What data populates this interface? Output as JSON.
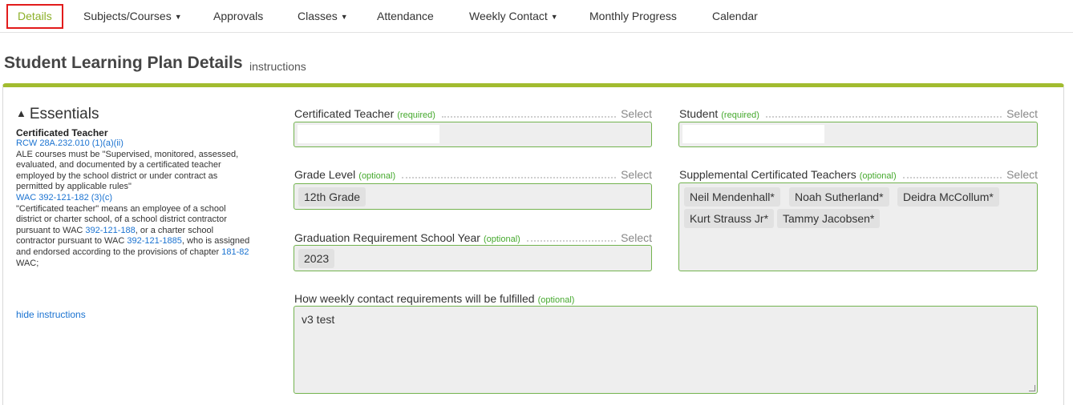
{
  "tabs": [
    {
      "label": "Details"
    },
    {
      "label": "Subjects/Courses"
    },
    {
      "label": "Approvals"
    },
    {
      "label": "Classes"
    },
    {
      "label": "Attendance"
    },
    {
      "label": "Weekly Contact"
    },
    {
      "label": "Monthly Progress"
    },
    {
      "label": "Calendar"
    }
  ],
  "header": {
    "title": "Student Learning Plan Details",
    "instructions": "instructions"
  },
  "sidebar": {
    "section_title": "Essentials",
    "heading": "Certificated Teacher",
    "rcw_link": "RCW 28A.232.010 (1)(a)(ii)",
    "text1": "ALE courses must be \"Supervised, monitored, assessed, evaluated, and documented by a certificated teacher employed by the school district or under contract as permitted by applicable rules\"",
    "wac_link": "WAC 392-121-182 (3)(c)",
    "text2a": "\"Certificated teacher\" means an employee of a school district or charter school, of a school district contractor pursuant to WAC ",
    "link_188": "392-121-188",
    "text2b": ", or a charter school contractor pursuant to WAC ",
    "link_1885": "392-121-1885",
    "text2c": ", who is assigned and endorsed according to the provisions of chapter ",
    "link_181": "181-82",
    "text2d": " WAC;",
    "hide": "hide instructions"
  },
  "form": {
    "select_label": "Select",
    "teacher": {
      "label": "Certificated Teacher",
      "tag": "(required)"
    },
    "student": {
      "label": "Student",
      "tag": "(required)"
    },
    "grade": {
      "label": "Grade Level",
      "tag": "(optional)",
      "value": "12th Grade"
    },
    "supplemental": {
      "label": "Supplemental Certificated Teachers",
      "tag": "(optional)",
      "chips": [
        "Neil Mendenhall*",
        "Noah Sutherland*",
        "Deidra McCollum*",
        "Kurt Strauss Jr*",
        "Tammy Jacobsen*"
      ]
    },
    "grad_year": {
      "label": "Graduation Requirement School Year",
      "tag": "(optional)",
      "value": "2023"
    },
    "weekly": {
      "label": "How weekly contact requirements will be fulfilled",
      "tag": "(optional)",
      "value": "v3 test"
    }
  }
}
